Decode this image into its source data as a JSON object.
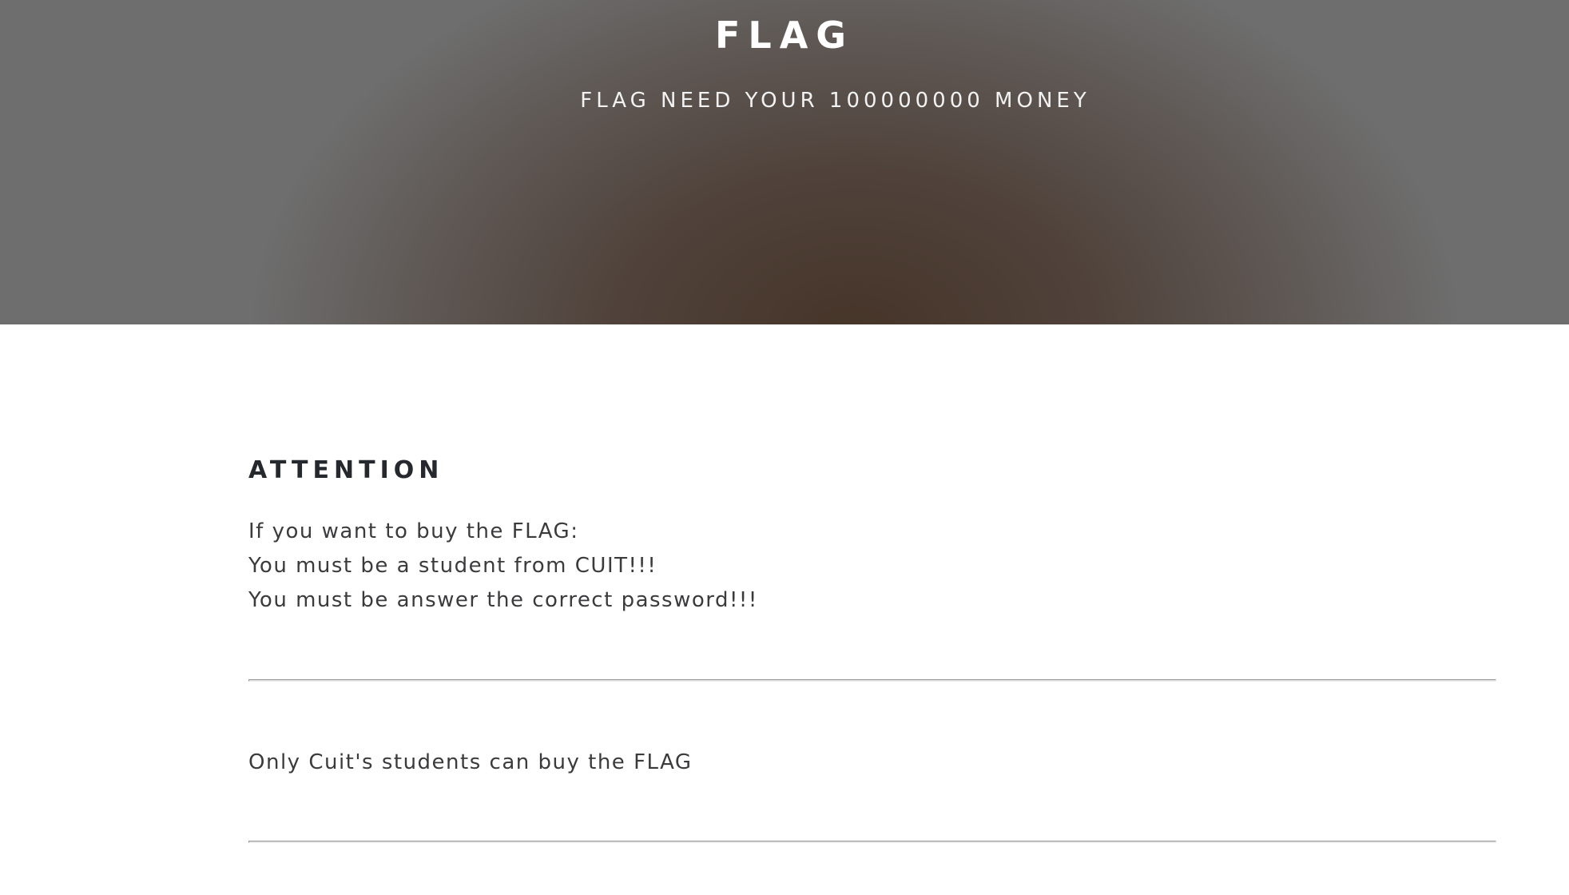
{
  "hero": {
    "title": "FLAG",
    "subtitle": "FLAG NEED YOUR 100000000 MONEY"
  },
  "attention": {
    "heading": "ATTENTION",
    "lines": [
      "If you want to buy the FLAG:",
      "You must be a student from CUIT!!!",
      "You must be answer the correct password!!!"
    ]
  },
  "note": {
    "text": "Only Cuit's students can buy the FLAG"
  },
  "colors": {
    "hero_center": "#463428",
    "hero_edge": "#6e6e6e",
    "heading_text": "#25292e",
    "body_text": "#3b3a3d",
    "divider": "#dcdde0"
  }
}
